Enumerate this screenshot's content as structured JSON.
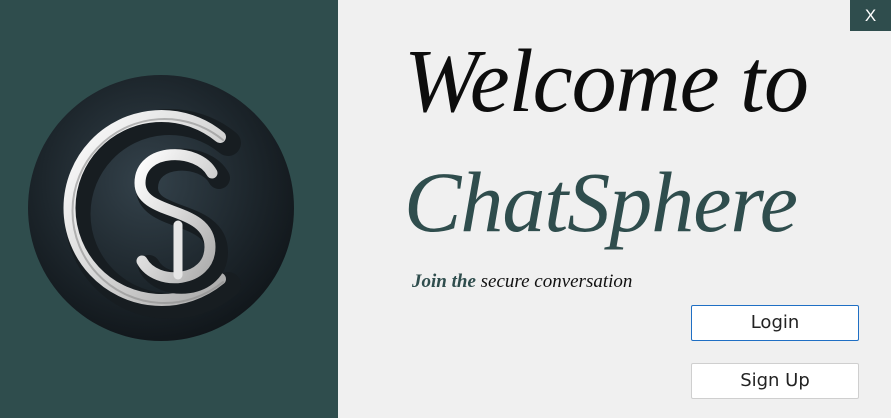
{
  "window": {
    "close_label": "X"
  },
  "logo": {
    "icon": "chatsphere-logo-icon"
  },
  "welcome": {
    "line1": "Welcome to",
    "line2": "ChatSphere"
  },
  "tagline": {
    "accent": "Join the",
    "rest": " secure conversation"
  },
  "buttons": {
    "login": "Login",
    "signup": "Sign Up"
  },
  "colors": {
    "panel": "#2f4d4d",
    "background": "#f0f0f0",
    "login_border": "#1f6fc4"
  }
}
